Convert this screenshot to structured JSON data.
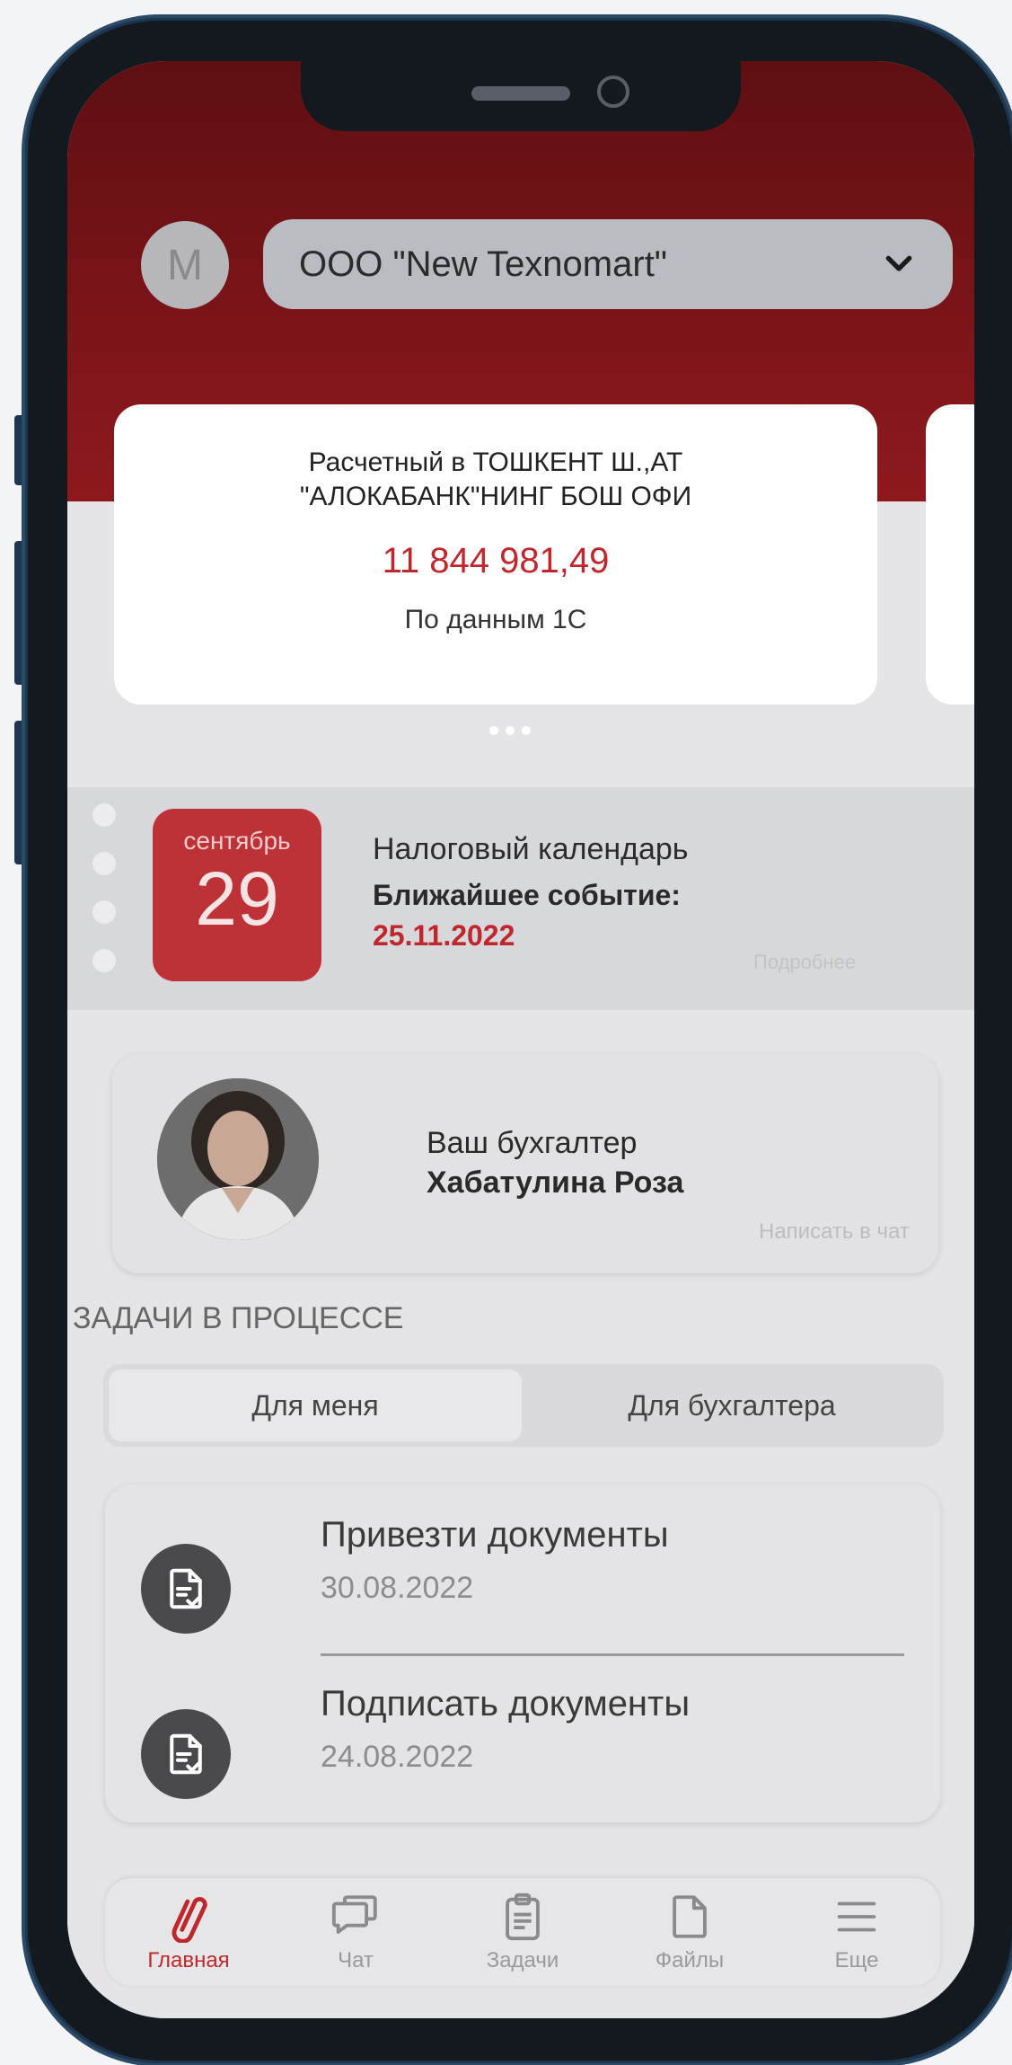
{
  "header": {
    "avatar_letter": "M",
    "company": "ООО \"New Texnomart\""
  },
  "account_card": {
    "name": "Расчетный в ТОШКЕНТ Ш.,АТ\n\"АЛОКАБАНК\"НИНГ БОШ ОФИ",
    "amount": "11 844 981,49",
    "source": "По данным 1С"
  },
  "tax_calendar": {
    "month": "сентябрь",
    "day": "29",
    "title": "Налоговый календарь",
    "next_event_label": "Ближайшее событие:",
    "next_event_date": "25.11.2022",
    "more_link": "Подробнее"
  },
  "accountant": {
    "role": "Ваш бухгалтер",
    "name": "Хабатулина Роза",
    "chat_link": "Написать в чат"
  },
  "tasks": {
    "heading": "ЗАДАЧИ В ПРОЦЕССЕ",
    "tabs": [
      "Для меня",
      "Для бухгалтера"
    ],
    "items": [
      {
        "title": "Привезти документы",
        "date": "30.08.2022"
      },
      {
        "title": "Подписать документы",
        "date": "24.08.2022"
      }
    ]
  },
  "tabbar": {
    "items": [
      {
        "label": "Главная",
        "icon": "paperclip-icon",
        "active": true
      },
      {
        "label": "Чат",
        "icon": "chat-icon",
        "active": false
      },
      {
        "label": "Задачи",
        "icon": "clipboard-icon",
        "active": false
      },
      {
        "label": "Файлы",
        "icon": "file-icon",
        "active": false
      },
      {
        "label": "Еще",
        "icon": "menu-icon",
        "active": false
      }
    ]
  },
  "colors": {
    "brand_red": "#c0272d",
    "header_dark_red": "#6a1014"
  }
}
